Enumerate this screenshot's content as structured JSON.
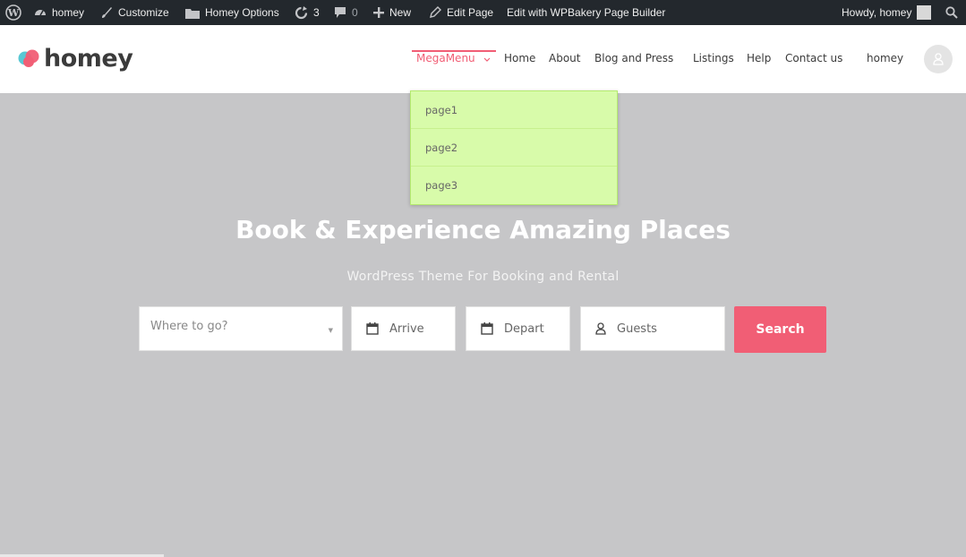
{
  "admin_bar": {
    "site_name": "homey",
    "customize": "Customize",
    "options": "Homey Options",
    "updates_count": "3",
    "comments_count": "0",
    "new": "New",
    "edit_page": "Edit Page",
    "edit_builder": "Edit with WPBakery Page Builder",
    "greeting": "Howdy, homey"
  },
  "header": {
    "logo_text": "homey",
    "nav": [
      {
        "label": "MegaMenu"
      },
      {
        "label": "Home"
      },
      {
        "label": "About"
      },
      {
        "label": "Blog and Press"
      },
      {
        "label": "Listings"
      },
      {
        "label": "Help"
      },
      {
        "label": "Contact us"
      }
    ],
    "user_name": "homey"
  },
  "megamenu": {
    "items": [
      {
        "label": "page1"
      },
      {
        "label": "page2"
      },
      {
        "label": "page3"
      }
    ]
  },
  "hero": {
    "title": "Book & Experience Amazing Places",
    "subtitle": "WordPress Theme For Booking and Rental"
  },
  "search": {
    "where_placeholder": "Where to go?",
    "arrive": "Arrive",
    "depart": "Depart",
    "guests": "Guests",
    "button": "Search"
  },
  "colors": {
    "accent": "#f15e75",
    "admin_bar": "#23282d",
    "dropdown_bg": "#d8fbaa",
    "hero_bg": "#c6c6c8"
  }
}
